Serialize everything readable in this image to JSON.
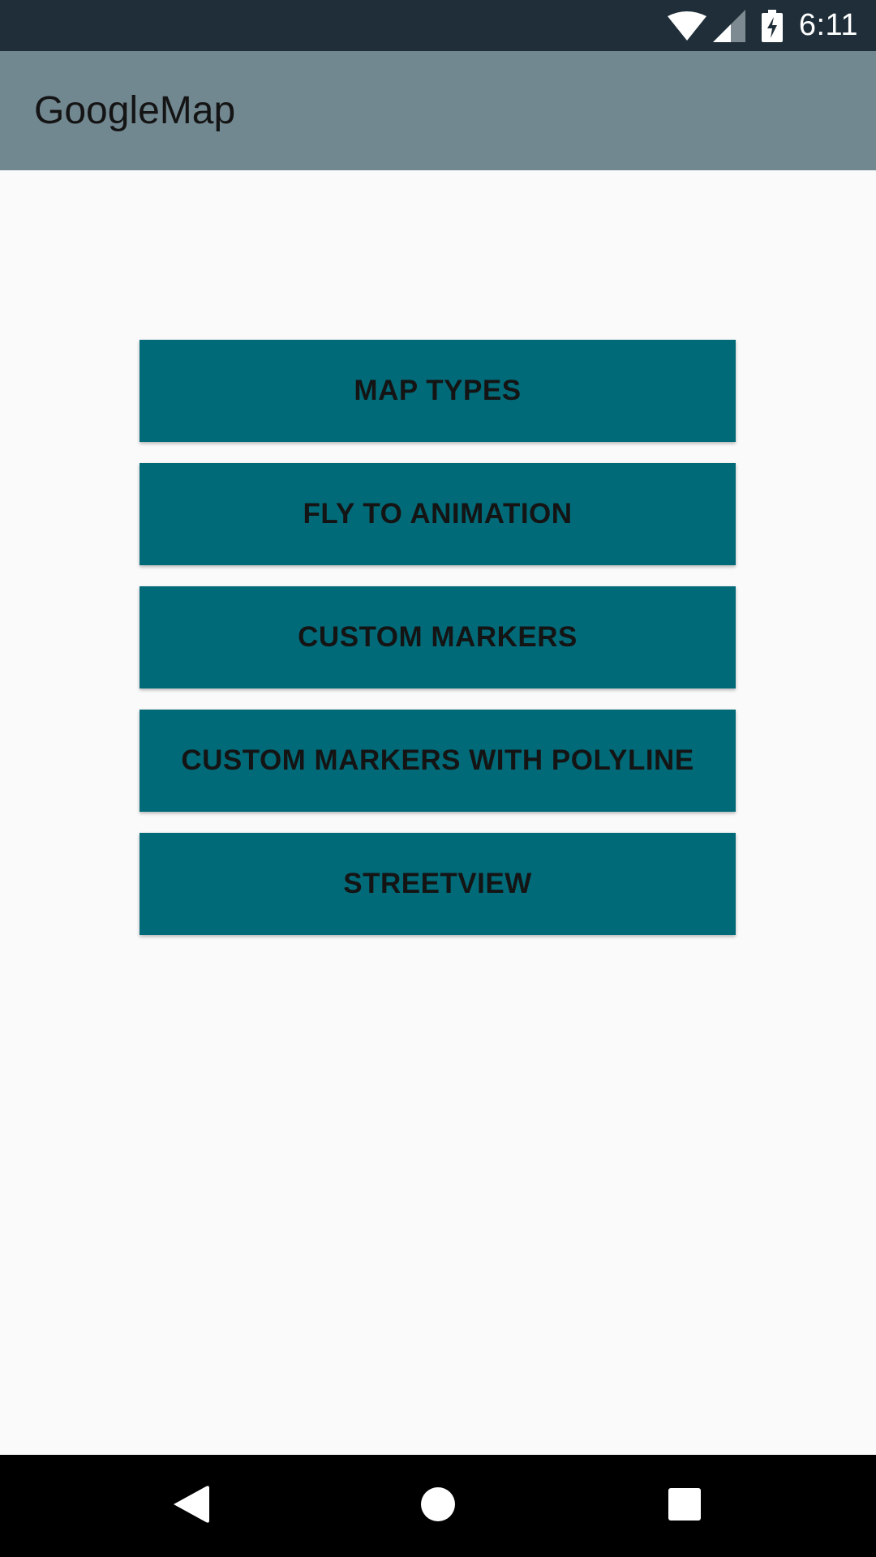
{
  "status_bar": {
    "time": "6:11",
    "icons": [
      "wifi-icon",
      "signal-icon",
      "battery-charging-icon"
    ]
  },
  "app_bar": {
    "title": "GoogleMap"
  },
  "menu": {
    "buttons": [
      {
        "label": "MAP TYPES"
      },
      {
        "label": "FLY TO ANIMATION"
      },
      {
        "label": "CUSTOM MARKERS"
      },
      {
        "label": "CUSTOM MARKERS WITH POLYLINE"
      },
      {
        "label": "STREETVIEW"
      }
    ]
  },
  "nav_bar": {
    "icons": [
      "back-icon",
      "home-icon",
      "recents-icon"
    ]
  },
  "colors": {
    "status_bar": "#1f2e38",
    "app_bar": "#728891",
    "button": "#016a78",
    "background": "#fafafa",
    "nav_bar": "#000000"
  }
}
